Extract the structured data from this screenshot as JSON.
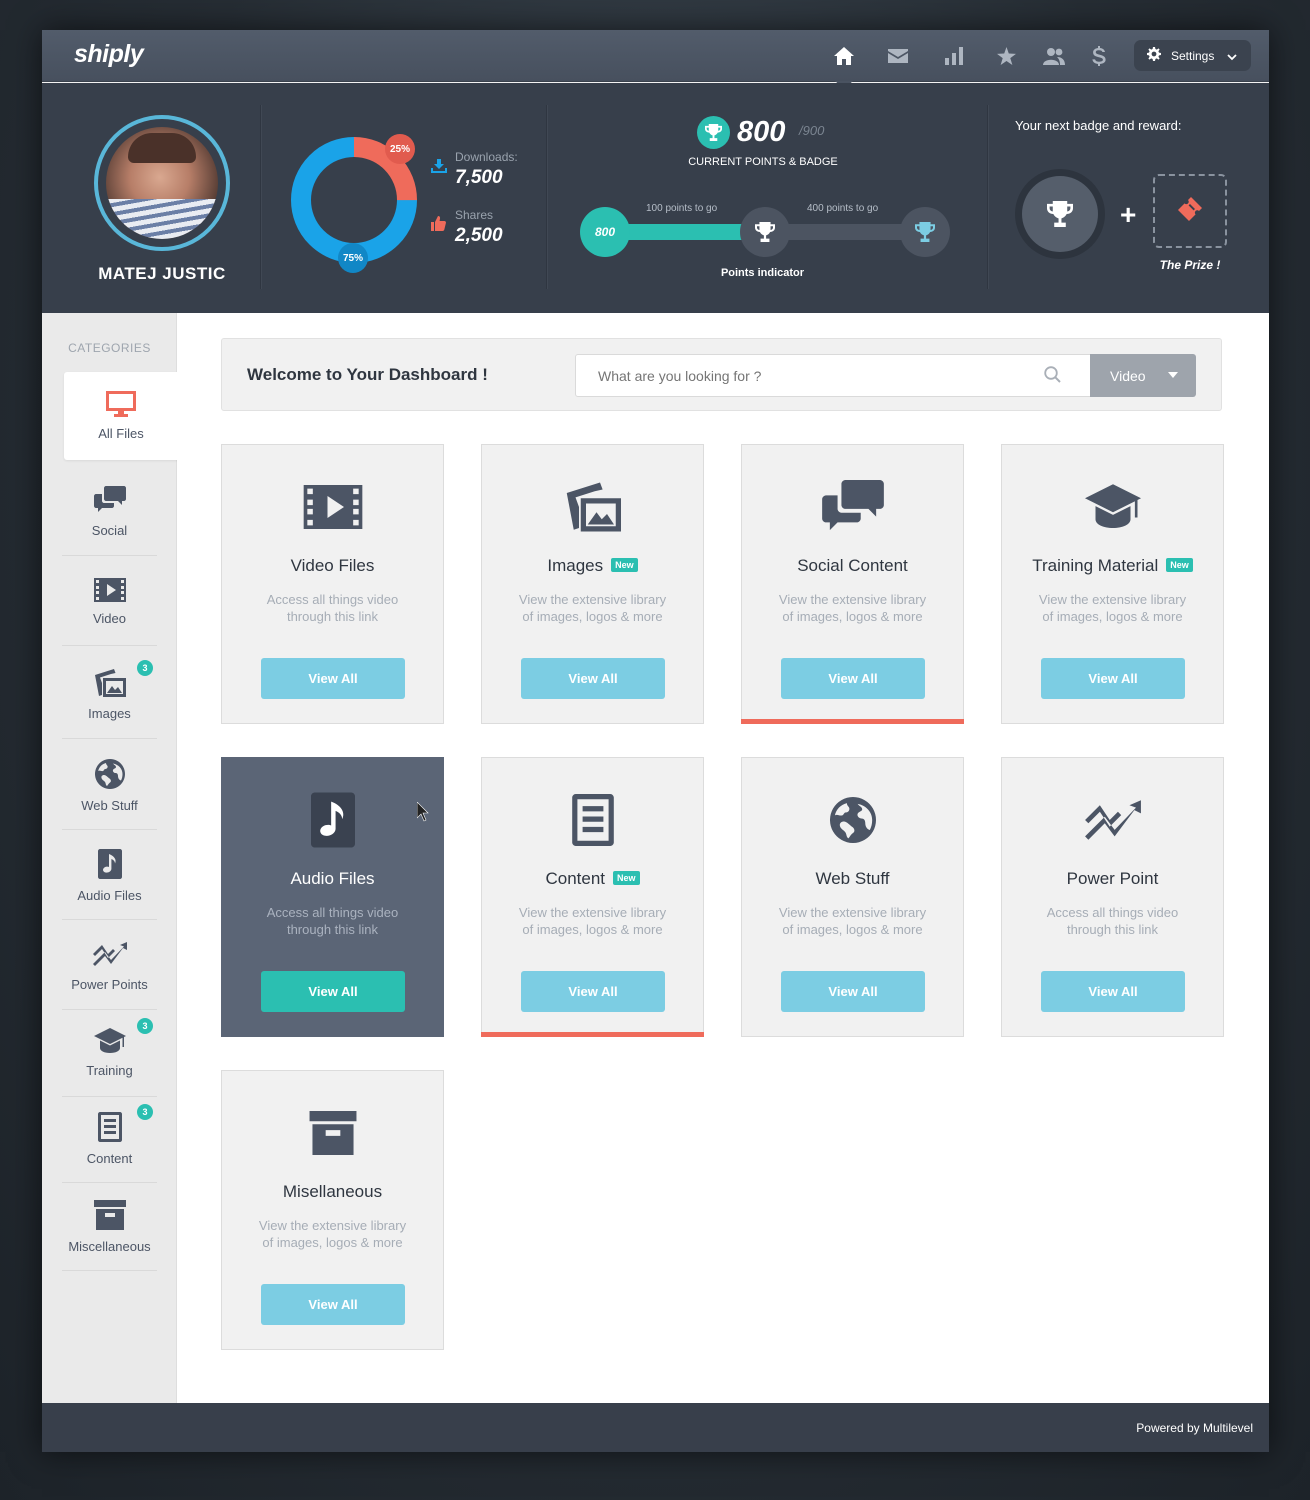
{
  "app": {
    "logo": "shiply"
  },
  "nav": {
    "icons": [
      "home-icon",
      "mail-icon",
      "stats-icon",
      "star-icon",
      "users-icon",
      "dollar-icon"
    ],
    "active": "home-icon",
    "settings_label": "Settings"
  },
  "profile": {
    "name": "MATEJ JUSTIC",
    "donut": {
      "primary_percent": "75%",
      "secondary_percent": "25%",
      "primary_value": 75,
      "secondary_value": 25,
      "primary_color": "#1aa3e8",
      "secondary_color": "#ef6b5b"
    },
    "downloads_label": "Downloads:",
    "downloads_value": "7,500",
    "shares_label": "Shares",
    "shares_value": "2,500"
  },
  "points": {
    "current": "800",
    "max": "/900",
    "caption": "CURRENT POINTS & BADGE",
    "start_label": "800",
    "togo_1": "100 points to go",
    "togo_2": "400 points to go",
    "indicator_label": "Points indicator",
    "progress_fraction": 0.44
  },
  "reward": {
    "title": "Your next badge and reward:",
    "plus": "+",
    "prize_label": "The Prize !"
  },
  "sidebar": {
    "title": "CATEGORIES",
    "items": [
      {
        "label": "All Files",
        "icon": "monitor-icon",
        "badge": ""
      },
      {
        "label": "Social",
        "icon": "chat-icon",
        "badge": ""
      },
      {
        "label": "Video",
        "icon": "film-icon",
        "badge": ""
      },
      {
        "label": "Images",
        "icon": "images-icon",
        "badge": "3"
      },
      {
        "label": "Web Stuff",
        "icon": "globe-icon",
        "badge": ""
      },
      {
        "label": "Audio Files",
        "icon": "music-icon",
        "badge": ""
      },
      {
        "label": "Power Points",
        "icon": "chart-line-icon",
        "badge": ""
      },
      {
        "label": "Training",
        "icon": "graduation-cap-icon",
        "badge": "3"
      },
      {
        "label": "Content",
        "icon": "document-icon",
        "badge": "3"
      },
      {
        "label": "Miscellaneous",
        "icon": "archive-icon",
        "badge": ""
      }
    ]
  },
  "main": {
    "welcome": "Welcome to Your Dashboard !",
    "search_placeholder": "What are you looking for ?",
    "select_value": "Video",
    "cards": [
      {
        "title": "Video Files",
        "new": "",
        "desc": "Access all things video through this link",
        "button": "View All",
        "icon": "film-icon"
      },
      {
        "title": "Images",
        "new": "New",
        "desc": "View the extensive library of images, logos & more",
        "button": "View All",
        "icon": "images-icon"
      },
      {
        "title": "Social Content",
        "new": "",
        "desc": "View the extensive library of images, logos & more",
        "button": "View All",
        "icon": "chat-icon"
      },
      {
        "title": "Training Material",
        "new": "New",
        "desc": "View the extensive library of images, logos & more",
        "button": "View All",
        "icon": "graduation-cap-icon"
      },
      {
        "title": "Audio Files",
        "new": "",
        "desc": "Access all things video through this link",
        "button": "View All",
        "icon": "music-icon"
      },
      {
        "title": "Content",
        "new": "New",
        "desc": "View the extensive library of images, logos & more",
        "button": "View All",
        "icon": "document-icon"
      },
      {
        "title": "Web Stuff",
        "new": "",
        "desc": "View the extensive library of images, logos & more",
        "button": "View All",
        "icon": "globe-icon"
      },
      {
        "title": "Power Point",
        "new": "",
        "desc": "Access all things video through this link",
        "button": "View All",
        "icon": "chart-line-icon"
      },
      {
        "title": "Misellaneous",
        "new": "",
        "desc": "View the extensive library of images, logos & more",
        "button": "View All",
        "icon": "archive-icon"
      }
    ]
  },
  "footer": {
    "powered": "Powered by Multilevel"
  },
  "colors": {
    "accent_teal": "#2bbfb1",
    "accent_red": "#ef6b5b",
    "button_blue": "#7ccde3",
    "dark": "#373f4b"
  }
}
